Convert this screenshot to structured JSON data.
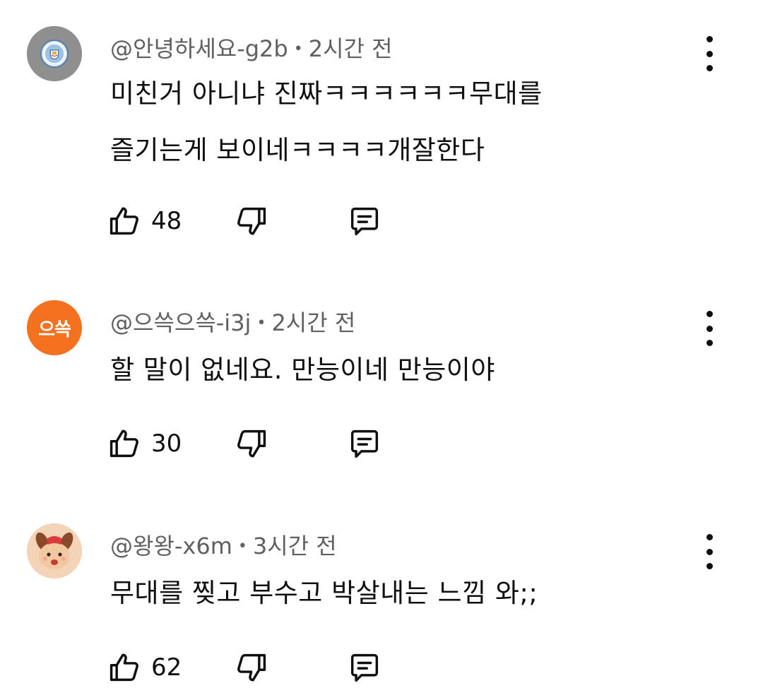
{
  "comments": [
    {
      "handle": "@안녕하세요-g2b",
      "time": "2시간 전",
      "text": "미친거 아니냐 진짜ㅋㅋㅋㅋㅋㅋ무대를\n즐기는게 보이네ㅋㅋㅋㅋ개잘한다",
      "likes": "48",
      "avatar": {
        "type": "club-crest",
        "bg": "#8a8a8a"
      }
    },
    {
      "handle": "@으쓱으쓱-i3j",
      "time": "2시간 전",
      "text": "할 말이 없네요. 만능이네 만능이야",
      "likes": "30",
      "avatar": {
        "type": "text",
        "label": "으쓱",
        "bg": "#f5701f"
      }
    },
    {
      "handle": "@왕왕-x6m",
      "time": "3시간 전",
      "text": "무대를 찢고 부수고 박살내는 느낌 와;;",
      "likes": "62",
      "avatar": {
        "type": "character",
        "bg": "#f3c9a8"
      }
    }
  ],
  "colors": {
    "meta_text": "#606060",
    "body_text": "#0f0f0f",
    "background": "#ffffff"
  },
  "icons": {
    "like": "thumbs-up-outline",
    "dislike": "thumbs-down-outline",
    "reply": "comment-bubble-outline",
    "menu": "vertical-ellipsis"
  }
}
